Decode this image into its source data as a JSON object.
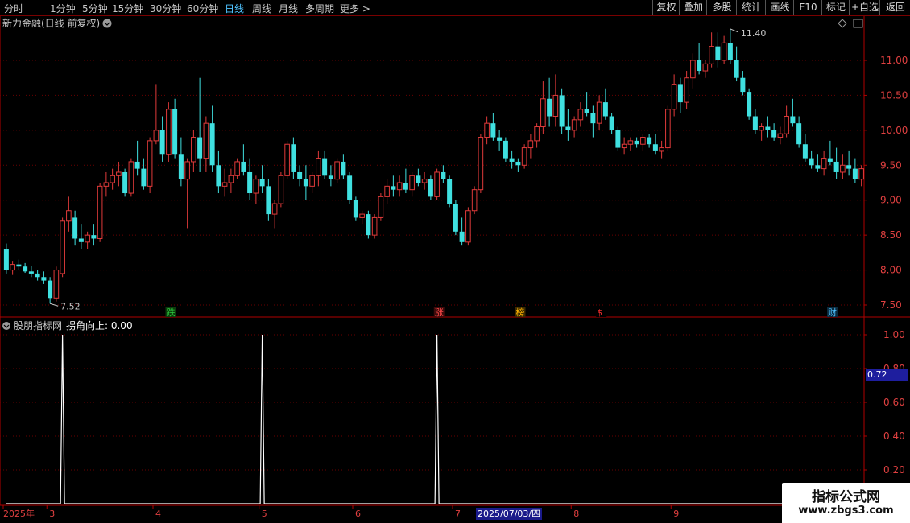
{
  "toolbar": {
    "left": [
      "分时",
      "1分钟",
      "5分钟",
      "15分钟",
      "30分钟",
      "60分钟",
      "日线",
      "周线",
      "月线",
      "多周期",
      "更多 >"
    ],
    "active_index": 6,
    "right": [
      "复权",
      "叠加",
      "多股",
      "统计",
      "画线",
      "F10",
      "标记",
      "+自选",
      "返回"
    ]
  },
  "main_panel": {
    "title": "新力金融(日线 前复权)",
    "y_ticks": [
      "11.00",
      "10.50",
      "10.00",
      "9.50",
      "9.00",
      "8.50",
      "8.00",
      "7.50"
    ],
    "y_values": [
      11.0,
      10.5,
      10.0,
      9.5,
      9.0,
      8.5,
      8.0,
      7.5
    ],
    "high_label": "11.40",
    "low_label": "7.52",
    "markers": [
      {
        "text": "跌",
        "color": "#2ecc40",
        "bg": "#0b3d0b",
        "idx": 26
      },
      {
        "text": "涨",
        "color": "#ff4a4a",
        "bg": "#3d0b0b",
        "idx": 69
      },
      {
        "text": "榜",
        "color": "#ffb400",
        "bg": "#3d2b00",
        "idx": 82
      },
      {
        "text": "$",
        "color": "#ff3030",
        "bg": "#000000",
        "idx": 95
      },
      {
        "text": "财",
        "color": "#4fc3ff",
        "bg": "#0b2a3d",
        "idx": 132
      }
    ],
    "up_color": "#e03a3a",
    "down_color": "#3fe0e0"
  },
  "sub_panel": {
    "title": "股朋指标网",
    "indicator_label": "拐角向上: 0.00",
    "y_ticks": [
      "1.00",
      "0.80",
      "0.60",
      "0.40",
      "0.20"
    ],
    "y_values": [
      1.0,
      0.8,
      0.6,
      0.4,
      0.2
    ],
    "current_value": "0.72",
    "spike_idx": [
      9,
      41,
      69
    ]
  },
  "x_axis": {
    "labels": [
      {
        "text": "2025年",
        "idx": 0
      },
      {
        "text": "3",
        "idx": 7
      },
      {
        "text": "4",
        "idx": 24
      },
      {
        "text": "5",
        "idx": 41
      },
      {
        "text": "6",
        "idx": 56
      },
      {
        "text": "7",
        "idx": 72
      },
      {
        "text": "8",
        "idx": 91
      },
      {
        "text": "9",
        "idx": 107
      }
    ],
    "cursor_date": "2025/07/03/四"
  },
  "watermark": {
    "line1": "指标公式网",
    "line2": "www.zbgs3.com"
  },
  "candles": [
    [
      8.3,
      8.38,
      7.95,
      8.0
    ],
    [
      8.0,
      8.12,
      7.93,
      8.08
    ],
    [
      8.08,
      8.15,
      8.0,
      8.05
    ],
    [
      8.05,
      8.1,
      7.96,
      7.98
    ],
    [
      7.98,
      8.06,
      7.9,
      7.95
    ],
    [
      7.95,
      8.0,
      7.85,
      7.9
    ],
    [
      7.9,
      7.98,
      7.8,
      7.85
    ],
    [
      7.85,
      7.9,
      7.52,
      7.6
    ],
    [
      7.6,
      8.05,
      7.55,
      8.0
    ],
    [
      7.95,
      8.75,
      7.9,
      8.7
    ],
    [
      8.7,
      9.05,
      8.55,
      8.85
    ],
    [
      8.75,
      8.85,
      8.35,
      8.45
    ],
    [
      8.45,
      8.65,
      8.3,
      8.4
    ],
    [
      8.4,
      8.55,
      8.3,
      8.5
    ],
    [
      8.5,
      8.65,
      8.35,
      8.45
    ],
    [
      8.45,
      9.25,
      8.4,
      9.2
    ],
    [
      9.2,
      9.4,
      9.05,
      9.25
    ],
    [
      9.25,
      9.45,
      9.15,
      9.35
    ],
    [
      9.35,
      9.55,
      9.2,
      9.4
    ],
    [
      9.4,
      9.45,
      9.05,
      9.1
    ],
    [
      9.1,
      9.6,
      9.05,
      9.55
    ],
    [
      9.55,
      9.85,
      9.35,
      9.45
    ],
    [
      9.45,
      9.6,
      9.15,
      9.2
    ],
    [
      9.2,
      9.9,
      9.1,
      9.85
    ],
    [
      9.85,
      10.65,
      9.8,
      10.0
    ],
    [
      10.0,
      10.2,
      9.55,
      9.65
    ],
    [
      9.65,
      10.4,
      9.55,
      10.3
    ],
    [
      10.3,
      10.45,
      9.6,
      9.65
    ],
    [
      9.65,
      9.9,
      9.2,
      9.3
    ],
    [
      9.3,
      9.6,
      8.6,
      9.55
    ],
    [
      9.55,
      10.0,
      9.4,
      9.9
    ],
    [
      9.9,
      10.75,
      9.4,
      9.6
    ],
    [
      9.6,
      10.2,
      9.4,
      10.1
    ],
    [
      10.1,
      10.35,
      9.4,
      9.5
    ],
    [
      9.5,
      9.7,
      9.1,
      9.2
    ],
    [
      9.2,
      9.45,
      9.05,
      9.25
    ],
    [
      9.25,
      9.45,
      9.1,
      9.35
    ],
    [
      9.35,
      9.6,
      9.3,
      9.55
    ],
    [
      9.55,
      9.8,
      9.35,
      9.4
    ],
    [
      9.4,
      9.6,
      9.0,
      9.1
    ],
    [
      9.1,
      9.35,
      8.95,
      9.3
    ],
    [
      9.3,
      9.5,
      9.1,
      9.2
    ],
    [
      9.2,
      9.3,
      8.7,
      8.8
    ],
    [
      8.8,
      9.0,
      8.6,
      8.95
    ],
    [
      8.95,
      9.4,
      8.9,
      9.35
    ],
    [
      9.35,
      9.85,
      9.3,
      9.8
    ],
    [
      9.8,
      9.9,
      9.3,
      9.4
    ],
    [
      9.4,
      9.5,
      9.2,
      9.3
    ],
    [
      9.3,
      9.5,
      9.0,
      9.2
    ],
    [
      9.2,
      9.4,
      9.1,
      9.35
    ],
    [
      9.35,
      9.7,
      9.2,
      9.6
    ],
    [
      9.6,
      9.7,
      9.3,
      9.35
    ],
    [
      9.35,
      9.5,
      9.2,
      9.3
    ],
    [
      9.3,
      9.6,
      9.25,
      9.55
    ],
    [
      9.55,
      9.65,
      9.3,
      9.35
    ],
    [
      9.35,
      9.4,
      8.95,
      9.0
    ],
    [
      9.0,
      9.05,
      8.7,
      8.75
    ],
    [
      8.75,
      8.85,
      8.65,
      8.8
    ],
    [
      8.8,
      8.85,
      8.45,
      8.5
    ],
    [
      8.5,
      8.8,
      8.45,
      8.75
    ],
    [
      8.75,
      9.1,
      8.7,
      9.05
    ],
    [
      9.05,
      9.3,
      8.95,
      9.2
    ],
    [
      9.2,
      9.35,
      9.05,
      9.15
    ],
    [
      9.15,
      9.35,
      9.05,
      9.25
    ],
    [
      9.25,
      9.45,
      9.1,
      9.15
    ],
    [
      9.15,
      9.4,
      9.05,
      9.35
    ],
    [
      9.35,
      9.45,
      9.2,
      9.25
    ],
    [
      9.25,
      9.4,
      9.15,
      9.3
    ],
    [
      9.3,
      9.35,
      9.0,
      9.05
    ],
    [
      9.05,
      9.45,
      9.0,
      9.4
    ],
    [
      9.4,
      9.5,
      9.25,
      9.3
    ],
    [
      9.3,
      9.35,
      8.9,
      8.95
    ],
    [
      8.95,
      9.0,
      8.5,
      8.55
    ],
    [
      8.55,
      8.75,
      8.35,
      8.4
    ],
    [
      8.4,
      8.9,
      8.35,
      8.85
    ],
    [
      8.85,
      9.2,
      8.8,
      9.15
    ],
    [
      9.15,
      9.95,
      9.1,
      9.9
    ],
    [
      9.9,
      10.2,
      9.8,
      10.1
    ],
    [
      10.1,
      10.25,
      9.85,
      9.9
    ],
    [
      9.9,
      10.0,
      9.7,
      9.85
    ],
    [
      9.85,
      9.9,
      9.55,
      9.6
    ],
    [
      9.6,
      9.7,
      9.45,
      9.55
    ],
    [
      9.55,
      9.6,
      9.4,
      9.5
    ],
    [
      9.5,
      9.8,
      9.45,
      9.75
    ],
    [
      9.75,
      9.95,
      9.6,
      9.85
    ],
    [
      9.85,
      10.1,
      9.75,
      10.05
    ],
    [
      10.05,
      10.7,
      9.95,
      10.45
    ],
    [
      10.45,
      10.75,
      10.05,
      10.2
    ],
    [
      10.2,
      10.8,
      10.05,
      10.5
    ],
    [
      10.5,
      10.6,
      9.95,
      10.05
    ],
    [
      10.05,
      10.3,
      9.85,
      10.0
    ],
    [
      10.0,
      10.2,
      9.9,
      10.15
    ],
    [
      10.15,
      10.4,
      10.05,
      10.3
    ],
    [
      10.3,
      10.55,
      10.2,
      10.25
    ],
    [
      10.25,
      10.35,
      9.9,
      10.1
    ],
    [
      10.1,
      10.5,
      10.0,
      10.4
    ],
    [
      10.4,
      10.6,
      10.15,
      10.2
    ],
    [
      10.2,
      10.25,
      9.95,
      10.0
    ],
    [
      10.0,
      10.05,
      9.7,
      9.75
    ],
    [
      9.75,
      9.9,
      9.65,
      9.8
    ],
    [
      9.8,
      9.9,
      9.7,
      9.85
    ],
    [
      9.85,
      9.9,
      9.75,
      9.8
    ],
    [
      9.8,
      9.95,
      9.7,
      9.9
    ],
    [
      9.9,
      9.95,
      9.75,
      9.8
    ],
    [
      9.8,
      9.95,
      9.65,
      9.7
    ],
    [
      9.7,
      9.85,
      9.6,
      9.75
    ],
    [
      9.75,
      10.35,
      9.7,
      10.3
    ],
    [
      10.3,
      10.8,
      10.2,
      10.65
    ],
    [
      10.65,
      10.75,
      10.25,
      10.4
    ],
    [
      10.4,
      10.85,
      10.3,
      10.75
    ],
    [
      10.75,
      11.1,
      10.6,
      11.0
    ],
    [
      11.0,
      11.25,
      10.8,
      10.85
    ],
    [
      10.85,
      11.0,
      10.75,
      10.95
    ],
    [
      10.95,
      11.4,
      10.9,
      11.2
    ],
    [
      11.2,
      11.4,
      10.9,
      11.0
    ],
    [
      11.0,
      11.35,
      10.95,
      11.25
    ],
    [
      11.25,
      11.45,
      10.95,
      11.0
    ],
    [
      11.0,
      11.2,
      10.7,
      10.75
    ],
    [
      10.75,
      10.85,
      10.5,
      10.55
    ],
    [
      10.55,
      10.6,
      10.15,
      10.2
    ],
    [
      10.2,
      10.3,
      9.95,
      10.0
    ],
    [
      10.0,
      10.1,
      9.85,
      10.05
    ],
    [
      10.05,
      10.2,
      9.9,
      10.0
    ],
    [
      10.0,
      10.1,
      9.85,
      9.9
    ],
    [
      9.9,
      10.05,
      9.8,
      9.95
    ],
    [
      9.95,
      10.35,
      9.9,
      10.2
    ],
    [
      10.2,
      10.45,
      10.05,
      10.1
    ],
    [
      10.1,
      10.2,
      9.75,
      9.8
    ],
    [
      9.8,
      9.95,
      9.55,
      9.6
    ],
    [
      9.6,
      9.7,
      9.45,
      9.5
    ],
    [
      9.5,
      9.65,
      9.4,
      9.45
    ],
    [
      9.45,
      9.7,
      9.35,
      9.6
    ],
    [
      9.6,
      9.85,
      9.5,
      9.55
    ],
    [
      9.55,
      9.75,
      9.3,
      9.4
    ],
    [
      9.4,
      9.65,
      9.3,
      9.5
    ],
    [
      9.5,
      9.7,
      9.35,
      9.45
    ],
    [
      9.45,
      9.6,
      9.25,
      9.3
    ],
    [
      9.3,
      9.5,
      9.2,
      9.45
    ]
  ]
}
